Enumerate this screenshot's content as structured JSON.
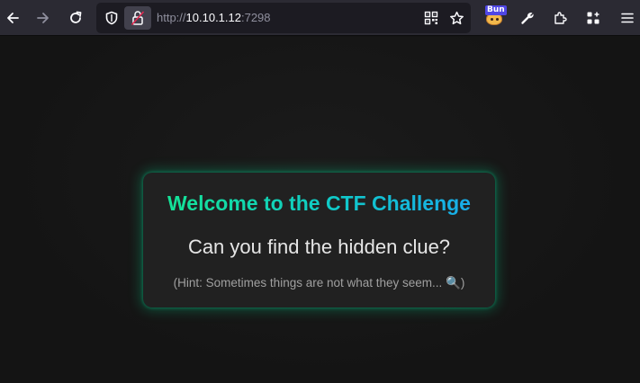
{
  "browser": {
    "url_scheme": "http://",
    "url_host": "10.10.1.12",
    "url_port": ":7298",
    "extension_badge": "Bun",
    "icons": {
      "back": "arrow-left-icon",
      "forward": "arrow-right-icon",
      "reload": "reload-icon",
      "tracking_protection": "shield-icon",
      "connection": "insecure-lock-icon",
      "qr_code": "qr-code-icon",
      "bookmark": "star-icon",
      "extension": "bun-extension-icon",
      "devtools": "wrench-icon",
      "extensions": "puzzle-icon",
      "containers": "grid-plus-icon",
      "menu": "hamburger-menu-icon"
    }
  },
  "page": {
    "title": "Welcome to the CTF Challenge",
    "question": "Can you find the hidden clue?",
    "hint": "(Hint: Sometimes things are not what they seem... 🔍)"
  },
  "colors": {
    "page_background": "#141414",
    "card_background": "#212121",
    "title_gradient_start": "#15e68f",
    "title_gradient_end": "#1aa7f0",
    "card_glow": "#00e696"
  }
}
